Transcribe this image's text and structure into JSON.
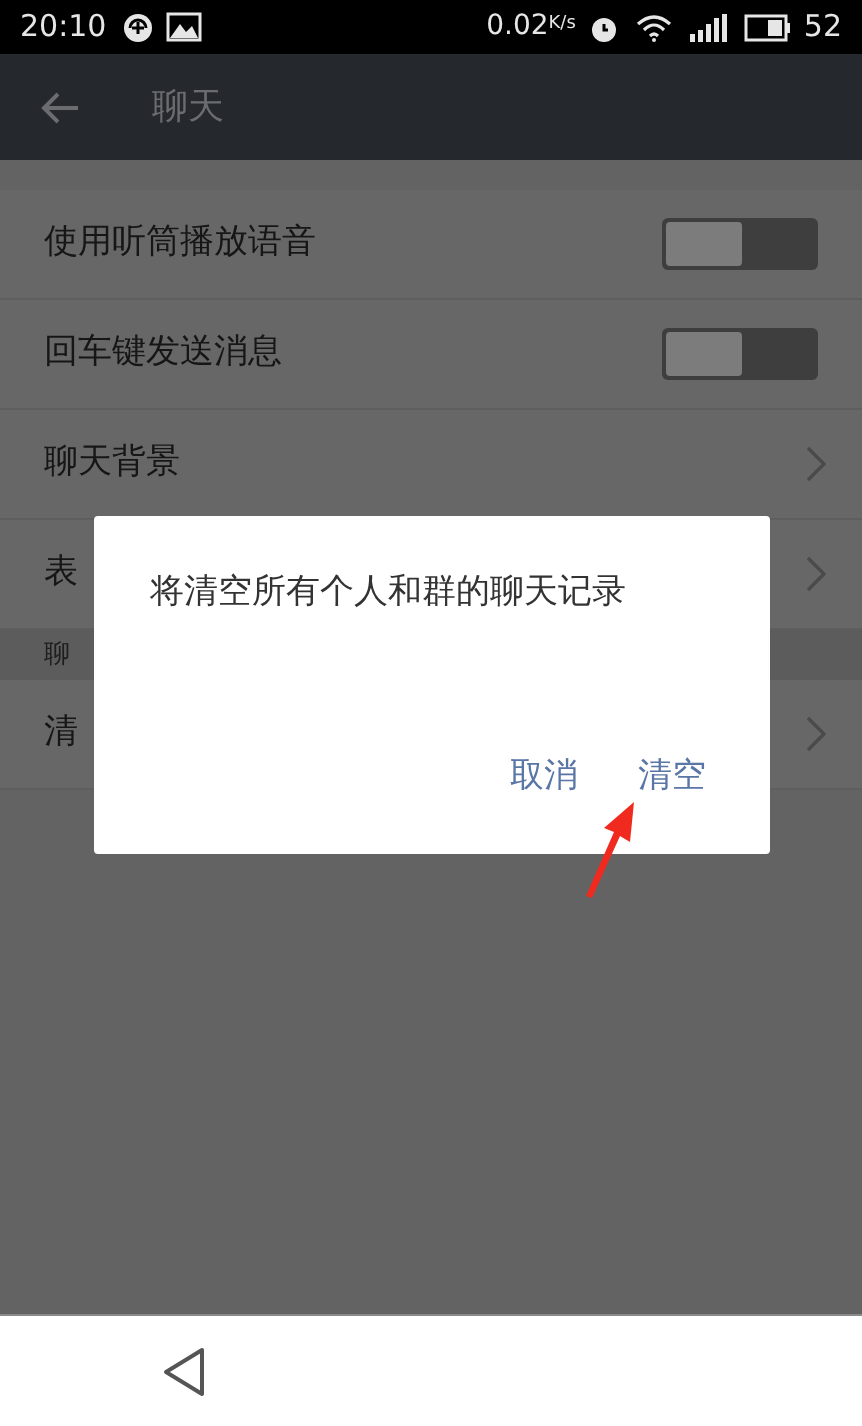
{
  "status_bar": {
    "time": "20:10",
    "net_speed": "0.02",
    "net_speed_unit": "K/s",
    "battery": "52"
  },
  "title_bar": {
    "title": "聊天"
  },
  "settings": [
    {
      "kind": "toggle",
      "label": "使用听筒播放语音",
      "on": false
    },
    {
      "kind": "toggle",
      "label": "回车键发送消息",
      "on": false
    },
    {
      "kind": "link",
      "label": "聊天背景"
    },
    {
      "kind": "link",
      "label": "表"
    },
    {
      "kind": "header",
      "label": "聊"
    },
    {
      "kind": "link",
      "label": "清"
    }
  ],
  "dialog": {
    "message": "将清空所有个人和群的聊天记录",
    "buttons": [
      "取消",
      "清空"
    ]
  }
}
